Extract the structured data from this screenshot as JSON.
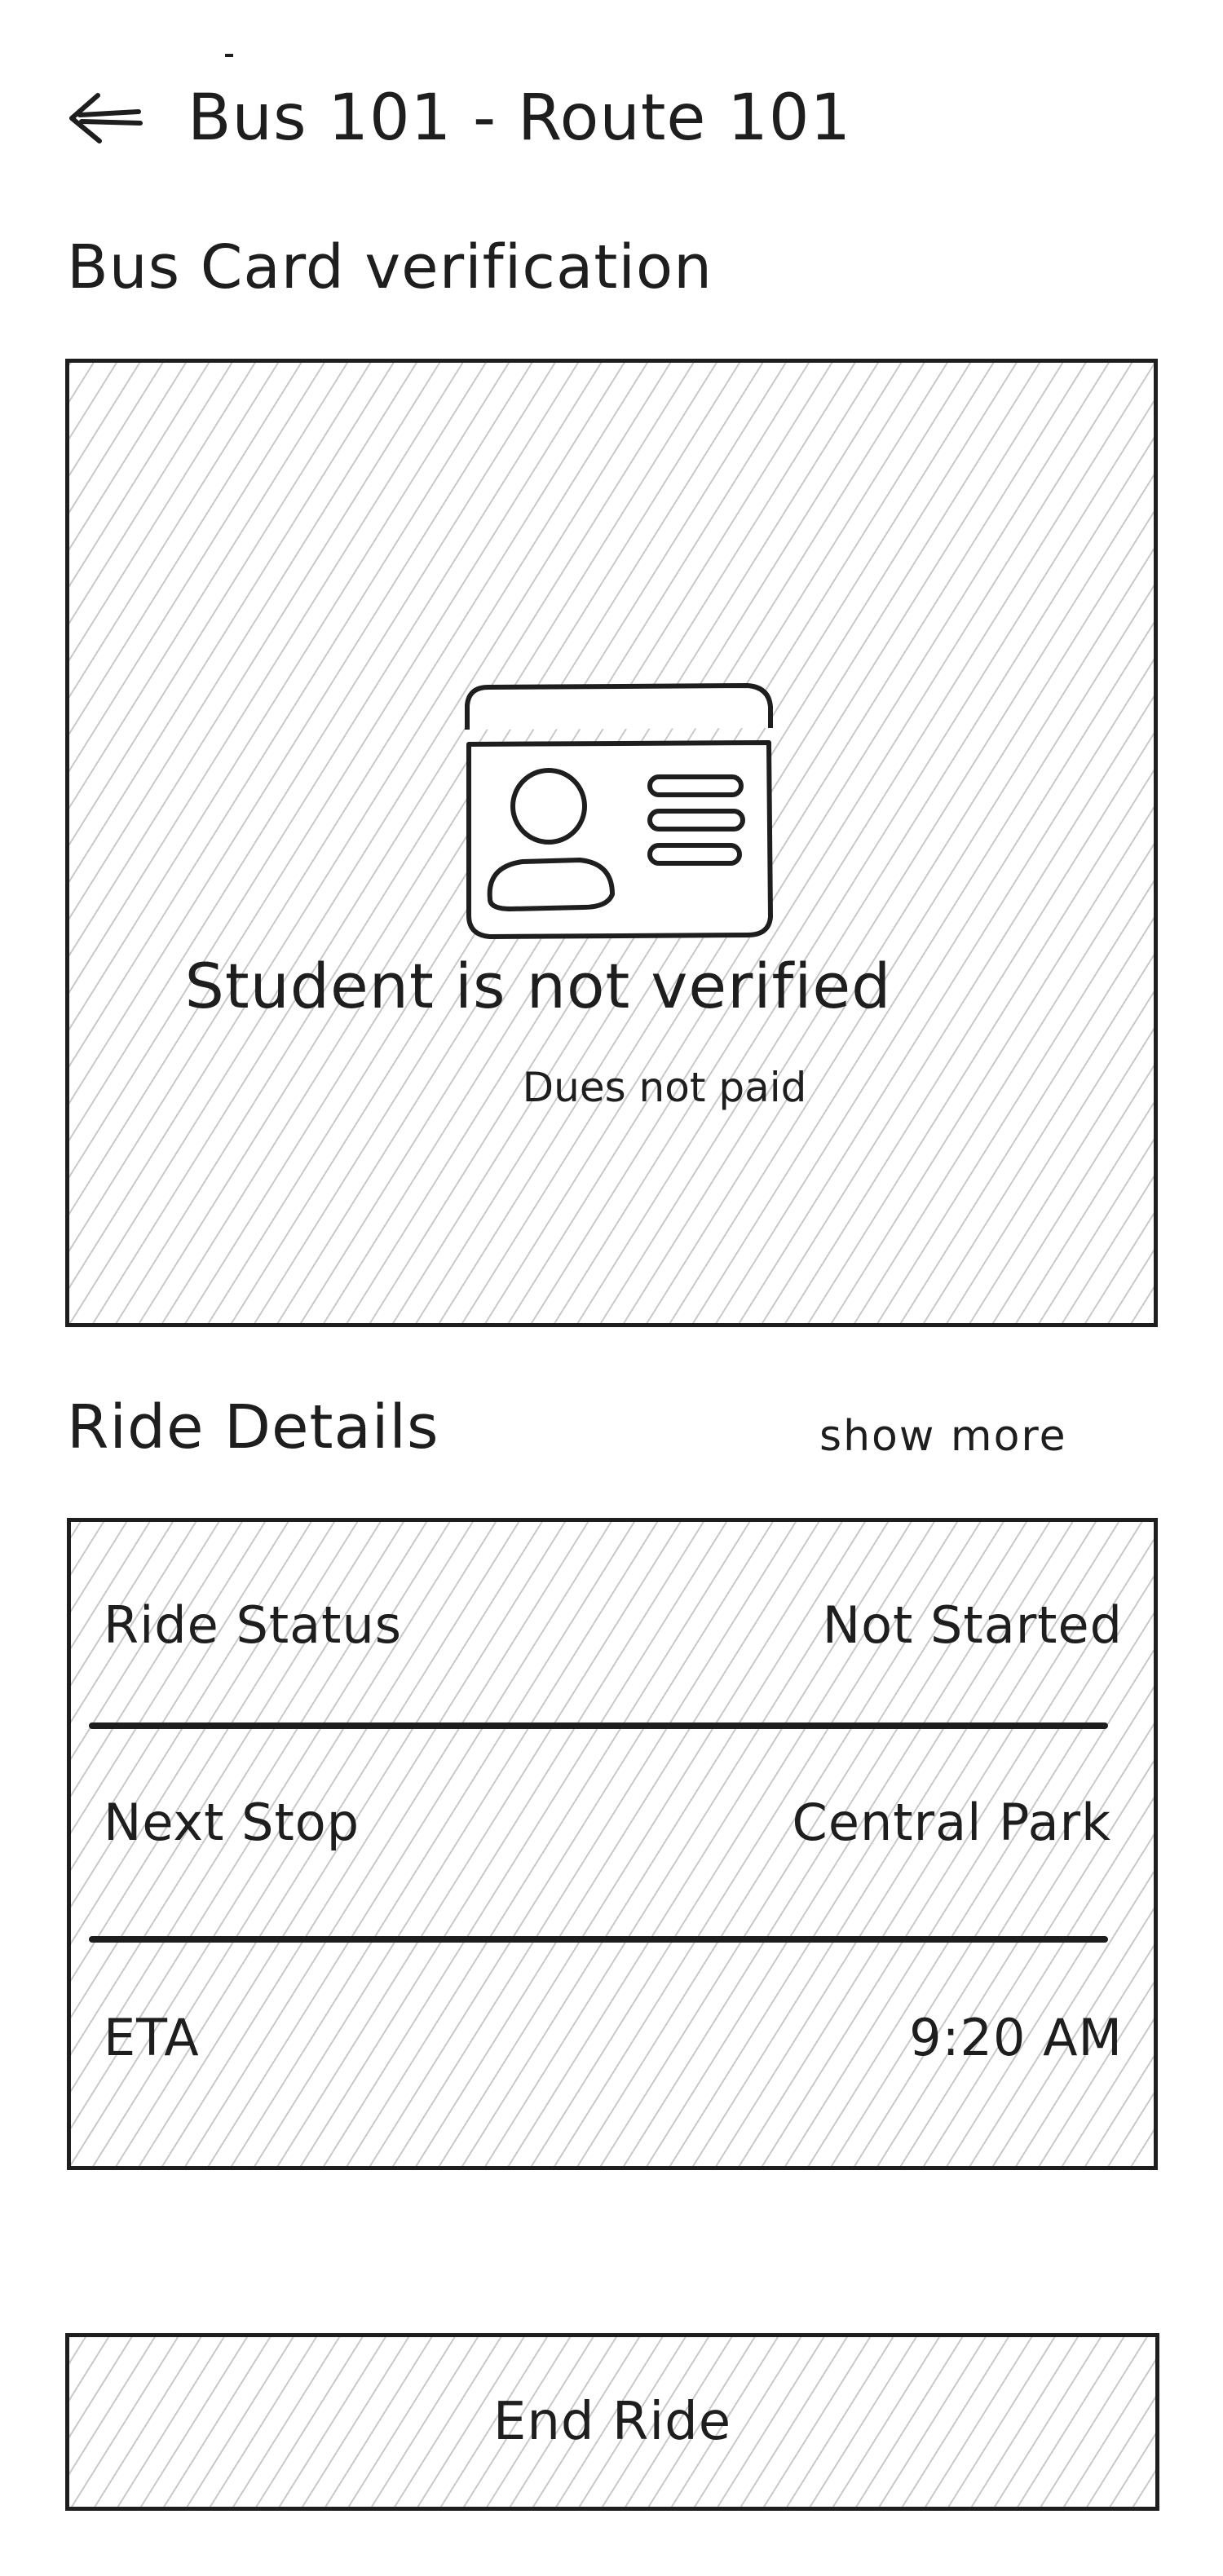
{
  "header": {
    "title": "Bus 101 - Route 101",
    "back_icon": "arrow-left-icon"
  },
  "verification": {
    "section_title": "Bus Card verification",
    "icon": "id-card-icon",
    "status": "Student is not verified",
    "reason": "Dues not paid"
  },
  "ride_details": {
    "section_title": "Ride Details",
    "show_more_label": "show more",
    "rows": [
      {
        "label": "Ride Status",
        "value": "Not Started"
      },
      {
        "label": "Next Stop",
        "value": "Central Park"
      },
      {
        "label": "ETA",
        "value": "9:20 AM"
      }
    ]
  },
  "actions": {
    "end_ride_label": "End Ride"
  },
  "colors": {
    "ink": "#1e1e1e",
    "hatch": "#c9c9c9",
    "background": "#ffffff"
  }
}
